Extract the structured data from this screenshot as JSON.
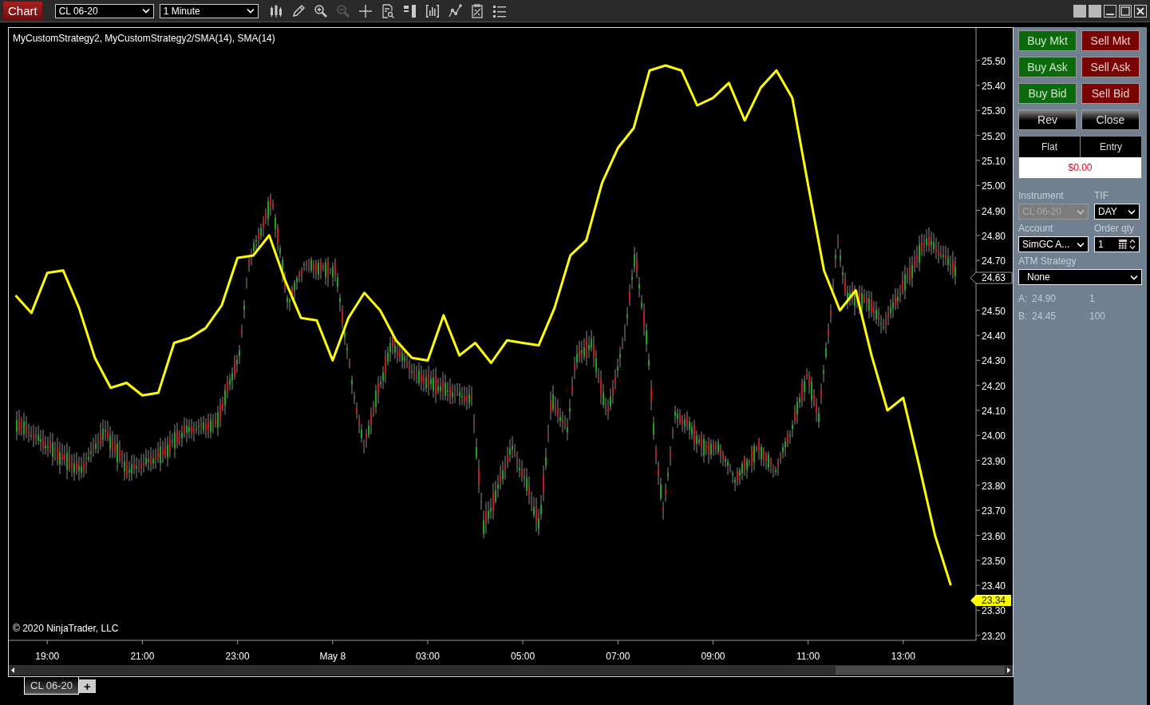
{
  "toolbar": {
    "title": "Chart",
    "instrument": "CL 06-20",
    "interval": "1 Minute",
    "tools": [
      {
        "kind": "candles",
        "disabled": false
      },
      {
        "kind": "pencil",
        "disabled": false
      },
      {
        "kind": "zoom-in",
        "disabled": false
      },
      {
        "kind": "zoom-out",
        "disabled": true
      },
      {
        "kind": "crosshair",
        "disabled": false
      },
      {
        "kind": "doc-search",
        "disabled": false
      },
      {
        "kind": "panel",
        "disabled": false
      },
      {
        "kind": "bars-box",
        "disabled": false
      },
      {
        "kind": "line-points",
        "disabled": false
      },
      {
        "kind": "doc-chart",
        "disabled": false
      },
      {
        "kind": "list",
        "disabled": false
      }
    ]
  },
  "chart": {
    "legend": "MyCustomStrategy2, MyCustomStrategy2/SMA(14), SMA(14)",
    "copyright": "© 2020 NinjaTrader, LLC",
    "price_markers": [
      {
        "label": "24.63",
        "kind": "last"
      },
      {
        "label": "23.34",
        "kind": "indicator"
      }
    ],
    "chart_data": {
      "type": "line",
      "ylim": [
        23.18,
        25.63
      ],
      "categories": [
        null,
        null,
        "19:00",
        null,
        null,
        null,
        null,
        null,
        "21:00",
        null,
        null,
        null,
        null,
        null,
        "23:00",
        null,
        null,
        null,
        null,
        null,
        "May 8",
        null,
        null,
        null,
        null,
        null,
        "03:00",
        null,
        null,
        null,
        null,
        null,
        "05:00",
        null,
        null,
        null,
        null,
        null,
        "07:00",
        null,
        null,
        null,
        null,
        null,
        "09:00",
        null,
        null,
        null,
        null,
        null,
        "11:00",
        null,
        null,
        null,
        null,
        null,
        "13:00",
        null,
        null,
        null
      ],
      "yticks": [
        {
          "value": 23.2,
          "label": "23.20"
        },
        {
          "value": 23.3,
          "label": "23.30"
        },
        {
          "value": 23.4,
          "label": "23.40"
        },
        {
          "value": 23.5,
          "label": "23.50"
        },
        {
          "value": 23.6,
          "label": "23.60"
        },
        {
          "value": 23.7,
          "label": "23.70"
        },
        {
          "value": 23.8,
          "label": "23.80"
        },
        {
          "value": 23.9,
          "label": "23.90"
        },
        {
          "value": 24.0,
          "label": "24.00"
        },
        {
          "value": 24.1,
          "label": "24.10"
        },
        {
          "value": 24.2,
          "label": "24.20"
        },
        {
          "value": 24.3,
          "label": "24.30"
        },
        {
          "value": 24.4,
          "label": "24.40"
        },
        {
          "value": 24.5,
          "label": "24.50"
        },
        {
          "value": 24.7,
          "label": "24.70"
        },
        {
          "value": 24.8,
          "label": "24.80"
        },
        {
          "value": 24.9,
          "label": "24.90"
        },
        {
          "value": 25.0,
          "label": "25.00"
        },
        {
          "value": 25.1,
          "label": "25.10"
        },
        {
          "value": 25.2,
          "label": "25.20"
        },
        {
          "value": 25.3,
          "label": "25.30"
        },
        {
          "value": 25.4,
          "label": "25.40"
        },
        {
          "value": 25.5,
          "label": "25.50"
        }
      ],
      "series": [
        {
          "color": "#ffff00",
          "values": [
            24.56,
            24.49,
            24.65,
            24.66,
            24.51,
            24.31,
            24.19,
            24.21,
            24.16,
            24.17,
            24.37,
            24.39,
            24.43,
            24.52,
            24.71,
            24.72,
            24.8,
            24.62,
            24.47,
            24.46,
            24.3,
            24.47,
            24.57,
            24.5,
            24.38,
            24.31,
            24.3,
            24.48,
            24.32,
            24.37,
            24.29,
            24.38,
            24.37,
            24.36,
            24.51,
            24.72,
            24.78,
            25.01,
            25.15,
            25.23,
            25.46,
            25.48,
            25.46,
            25.32,
            25.35,
            25.41,
            25.26,
            25.39,
            25.46,
            25.35,
            25.0,
            24.66,
            24.5,
            24.58,
            24.32,
            24.1,
            24.15,
            23.88,
            23.6,
            23.4
          ]
        }
      ]
    }
  },
  "tabs": [
    {
      "label": "CL 06-20",
      "selected": true
    }
  ],
  "add_tab": "+",
  "order_panel": {
    "buttons": [
      {
        "label": "Buy Mkt",
        "kind": "buy"
      },
      {
        "label": "Sell Mkt",
        "kind": "sell"
      },
      {
        "label": "Buy Ask",
        "kind": "buy"
      },
      {
        "label": "Sell Ask",
        "kind": "sell"
      },
      {
        "label": "Buy Bid",
        "kind": "buy"
      },
      {
        "label": "Sell Bid",
        "kind": "sell"
      },
      {
        "label": "Rev",
        "kind": "neutral"
      },
      {
        "label": "Close",
        "kind": "neutral"
      }
    ],
    "position": {
      "columns": [
        "Flat",
        "Entry"
      ],
      "pnl": "$0.00"
    },
    "fields": [
      {
        "label": "Instrument",
        "value": "CL 06-20",
        "kind": "select",
        "disabled": true
      },
      {
        "label": "TIF",
        "value": "DAY",
        "kind": "select",
        "disabled": false
      },
      {
        "label": "Account",
        "value": "SimGC A...",
        "kind": "select",
        "disabled": false
      },
      {
        "label": "Order qty",
        "value": "1",
        "kind": "spinner",
        "disabled": false
      }
    ],
    "atm_strategy": {
      "label": "ATM Strategy",
      "value": "None"
    },
    "quotes": [
      {
        "label": "A:",
        "price": "24.90",
        "size": "1"
      },
      {
        "label": "B:",
        "price": "24.45",
        "size": "100"
      }
    ]
  }
}
